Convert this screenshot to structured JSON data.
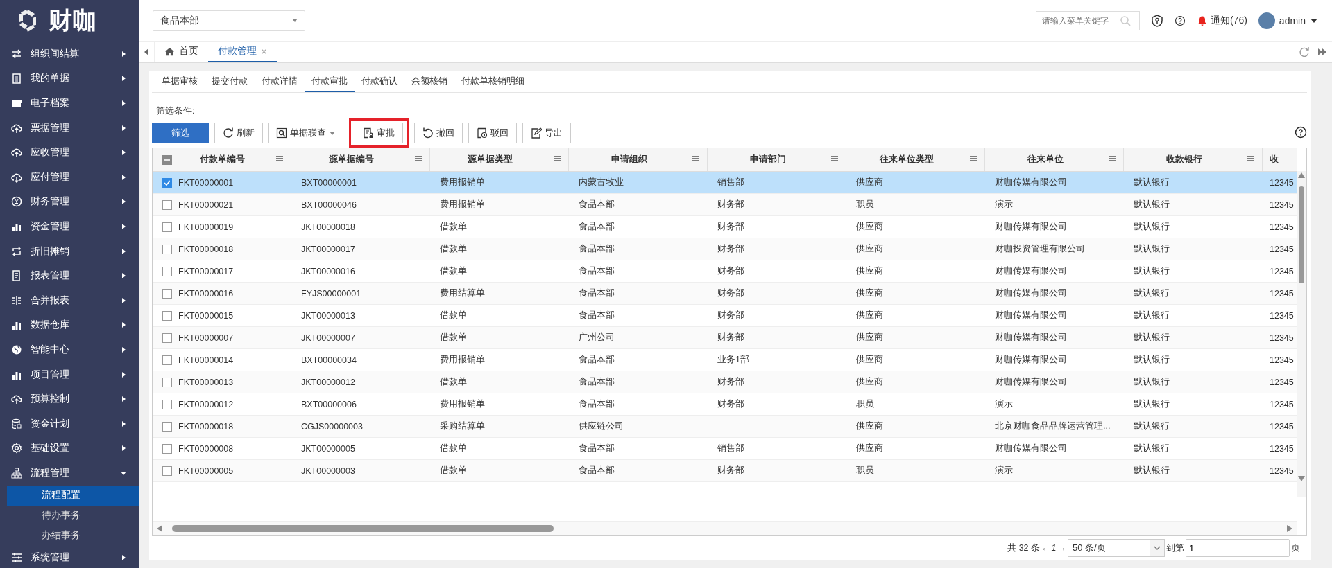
{
  "logo": {
    "text": "财咖"
  },
  "sidebar": {
    "items": [
      {
        "label": "组织间结算",
        "expanded": false
      },
      {
        "label": "我的单据",
        "expanded": false
      },
      {
        "label": "电子档案",
        "expanded": false
      },
      {
        "label": "票据管理",
        "expanded": false
      },
      {
        "label": "应收管理",
        "expanded": false
      },
      {
        "label": "应付管理",
        "expanded": false
      },
      {
        "label": "财务管理",
        "expanded": false
      },
      {
        "label": "资金管理",
        "expanded": false
      },
      {
        "label": "折旧摊销",
        "expanded": false
      },
      {
        "label": "报表管理",
        "expanded": false
      },
      {
        "label": "合并报表",
        "expanded": false
      },
      {
        "label": "数据仓库",
        "expanded": false
      },
      {
        "label": "智能中心",
        "expanded": false
      },
      {
        "label": "项目管理",
        "expanded": false
      },
      {
        "label": "预算控制",
        "expanded": false
      },
      {
        "label": "资金计划",
        "expanded": false
      },
      {
        "label": "基础设置",
        "expanded": false
      },
      {
        "label": "流程管理",
        "expanded": true,
        "children": [
          {
            "label": "流程配置",
            "selected": true
          },
          {
            "label": "待办事务",
            "selected": false
          },
          {
            "label": "办结事务",
            "selected": false
          }
        ]
      },
      {
        "label": "系统管理",
        "expanded": false
      }
    ]
  },
  "topbar": {
    "org_select": {
      "value": "食品本部"
    },
    "search": {
      "placeholder": "请输入菜单关键字"
    },
    "notifications": {
      "label": "通知(76)"
    },
    "user": {
      "name": "admin"
    }
  },
  "page_tabs": [
    {
      "label": "首页",
      "selected": false,
      "closable": false
    },
    {
      "label": "付款管理",
      "selected": true,
      "closable": true
    }
  ],
  "sub_tabs": [
    {
      "label": "单据审核",
      "selected": false
    },
    {
      "label": "提交付款",
      "selected": false
    },
    {
      "label": "付款详情",
      "selected": false
    },
    {
      "label": "付款审批",
      "selected": true
    },
    {
      "label": "付款确认",
      "selected": false
    },
    {
      "label": "余额核销",
      "selected": false
    },
    {
      "label": "付款单核销明细",
      "selected": false
    }
  ],
  "filter_label": "筛选条件:",
  "toolbar": [
    {
      "label": "筛选",
      "kind": "primary",
      "highlighted": false
    },
    {
      "label": "刷新",
      "kind": "refresh",
      "highlighted": false
    },
    {
      "label": "单据联查",
      "kind": "dropdown",
      "highlighted": false
    },
    {
      "label": "审批",
      "kind": "approve",
      "highlighted": true
    },
    {
      "label": "撤回",
      "kind": "undo",
      "highlighted": false
    },
    {
      "label": "驳回",
      "kind": "reject",
      "highlighted": false
    },
    {
      "label": "导出",
      "kind": "export",
      "highlighted": false
    }
  ],
  "table": {
    "select_all_partial": true,
    "columns": [
      "付款单编号",
      "源单据编号",
      "源单据类型",
      "申请组织",
      "申请部门",
      "往来单位类型",
      "往来单位",
      "收款银行",
      "收"
    ],
    "rows": [
      {
        "selected": true,
        "cells": [
          "FKT00000001",
          "BXT00000001",
          "费用报销单",
          "内蒙古牧业",
          "销售部",
          "供应商",
          "财咖传媒有限公司",
          "默认银行",
          "12345"
        ]
      },
      {
        "selected": false,
        "cells": [
          "FKT00000021",
          "BXT00000046",
          "费用报销单",
          "食品本部",
          "财务部",
          "职员",
          "演示",
          "默认银行",
          "12345"
        ]
      },
      {
        "selected": false,
        "cells": [
          "FKT00000019",
          "JKT00000018",
          "借款单",
          "食品本部",
          "财务部",
          "供应商",
          "财咖传媒有限公司",
          "默认银行",
          "12345"
        ]
      },
      {
        "selected": false,
        "cells": [
          "FKT00000018",
          "JKT00000017",
          "借款单",
          "食品本部",
          "财务部",
          "供应商",
          "财咖投资管理有限公司",
          "默认银行",
          "12345"
        ]
      },
      {
        "selected": false,
        "cells": [
          "FKT00000017",
          "JKT00000016",
          "借款单",
          "食品本部",
          "财务部",
          "供应商",
          "财咖传媒有限公司",
          "默认银行",
          "12345"
        ]
      },
      {
        "selected": false,
        "cells": [
          "FKT00000016",
          "FYJS00000001",
          "费用结算单",
          "食品本部",
          "财务部",
          "供应商",
          "财咖传媒有限公司",
          "默认银行",
          "12345"
        ]
      },
      {
        "selected": false,
        "cells": [
          "FKT00000015",
          "JKT00000013",
          "借款单",
          "食品本部",
          "财务部",
          "供应商",
          "财咖传媒有限公司",
          "默认银行",
          "12345"
        ]
      },
      {
        "selected": false,
        "cells": [
          "FKT00000007",
          "JKT00000007",
          "借款单",
          "广州公司",
          "财务部",
          "供应商",
          "财咖传媒有限公司",
          "默认银行",
          "12345"
        ]
      },
      {
        "selected": false,
        "cells": [
          "FKT00000014",
          "BXT00000034",
          "费用报销单",
          "食品本部",
          "业务1部",
          "供应商",
          "财咖传媒有限公司",
          "默认银行",
          "12345"
        ]
      },
      {
        "selected": false,
        "cells": [
          "FKT00000013",
          "JKT00000012",
          "借款单",
          "食品本部",
          "财务部",
          "供应商",
          "财咖传媒有限公司",
          "默认银行",
          "12345"
        ]
      },
      {
        "selected": false,
        "cells": [
          "FKT00000012",
          "BXT00000006",
          "费用报销单",
          "食品本部",
          "财务部",
          "职员",
          "演示",
          "默认银行",
          "12345"
        ]
      },
      {
        "selected": false,
        "cells": [
          "FKT00000018",
          "CGJS00000003",
          "采购结算单",
          "供应链公司",
          null,
          "供应商",
          "北京财咖食品品牌运营管理...",
          "默认银行",
          "12345"
        ]
      },
      {
        "selected": false,
        "cells": [
          "FKT00000008",
          "JKT00000005",
          "借款单",
          "食品本部",
          "销售部",
          "供应商",
          "财咖传媒有限公司",
          "默认银行",
          "12345"
        ]
      },
      {
        "selected": false,
        "cells": [
          "FKT00000005",
          "JKT00000003",
          "借款单",
          "食品本部",
          "财务部",
          "职员",
          "演示",
          "默认银行",
          "12345"
        ]
      }
    ]
  },
  "pagination": {
    "total": "共 32 条",
    "prev": "←",
    "page": "1",
    "next": "→",
    "page_size": "50 条/页",
    "goto_label": "到第",
    "goto_value": "1",
    "suffix": "页"
  }
}
